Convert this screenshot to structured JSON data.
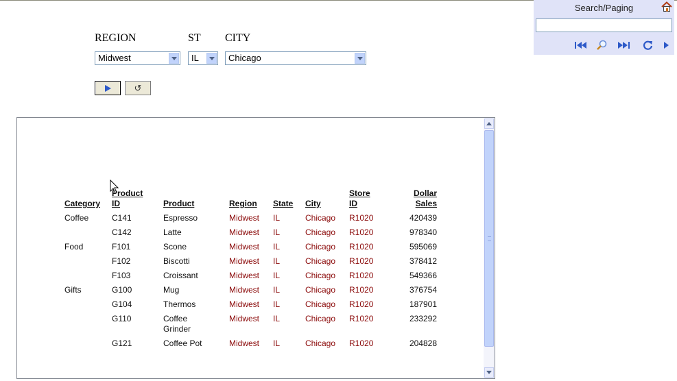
{
  "params": {
    "region_label": "REGION",
    "st_label": "ST",
    "city_label": "CITY",
    "region_value": "Midwest",
    "st_value": "IL",
    "city_value": "Chicago",
    "run_icon": "play-icon",
    "reset_icon": "reset-icon",
    "reset_glyph": "↺"
  },
  "panel": {
    "title": "Search/Paging",
    "search_value": "",
    "icons": [
      "home-icon",
      "first-page-icon",
      "search-icon",
      "last-page-icon",
      "refresh-icon",
      "next-arrow-icon"
    ]
  },
  "table": {
    "headers": {
      "category": "Category",
      "product_id_1": "Product",
      "product_id_2": "ID",
      "product": "Product",
      "region": "Region",
      "state": "State",
      "city": "City",
      "store_id_1": "Store",
      "store_id_2": "ID",
      "dollar_sales_1": "Dollar",
      "dollar_sales_2": "Sales"
    },
    "rows": [
      {
        "category": "Coffee",
        "product_id": "C141",
        "product": "Espresso",
        "product2": "",
        "region": "Midwest",
        "state": "IL",
        "city": "Chicago",
        "store_id": "R1020",
        "sales": "420439"
      },
      {
        "category": "",
        "product_id": "C142",
        "product": "Latte",
        "product2": "",
        "region": "Midwest",
        "state": "IL",
        "city": "Chicago",
        "store_id": "R1020",
        "sales": "978340"
      },
      {
        "category": "Food",
        "product_id": "F101",
        "product": "Scone",
        "product2": "",
        "region": "Midwest",
        "state": "IL",
        "city": "Chicago",
        "store_id": "R1020",
        "sales": "595069"
      },
      {
        "category": "",
        "product_id": "F102",
        "product": "Biscotti",
        "product2": "",
        "region": "Midwest",
        "state": "IL",
        "city": "Chicago",
        "store_id": "R1020",
        "sales": "378412"
      },
      {
        "category": "",
        "product_id": "F103",
        "product": "Croissant",
        "product2": "",
        "region": "Midwest",
        "state": "IL",
        "city": "Chicago",
        "store_id": "R1020",
        "sales": "549366"
      },
      {
        "category": "Gifts",
        "product_id": "G100",
        "product": "Mug",
        "product2": "",
        "region": "Midwest",
        "state": "IL",
        "city": "Chicago",
        "store_id": "R1020",
        "sales": "376754"
      },
      {
        "category": "",
        "product_id": "G104",
        "product": "Thermos",
        "product2": "",
        "region": "Midwest",
        "state": "IL",
        "city": "Chicago",
        "store_id": "R1020",
        "sales": "187901"
      },
      {
        "category": "",
        "product_id": "G110",
        "product": "Coffee",
        "product2": "Grinder",
        "region": "Midwest",
        "state": "IL",
        "city": "Chicago",
        "store_id": "R1020",
        "sales": "233292"
      },
      {
        "category": "",
        "product_id": "G121",
        "product": "Coffee Pot",
        "product2": "",
        "region": "Midwest",
        "state": "IL",
        "city": "Chicago",
        "store_id": "R1020",
        "sales": "204828"
      }
    ]
  },
  "colors": {
    "panel_bg": "#e0e3f8",
    "scroll_thumb": "#c1d3fb",
    "state_text": "#8b0a0a"
  }
}
